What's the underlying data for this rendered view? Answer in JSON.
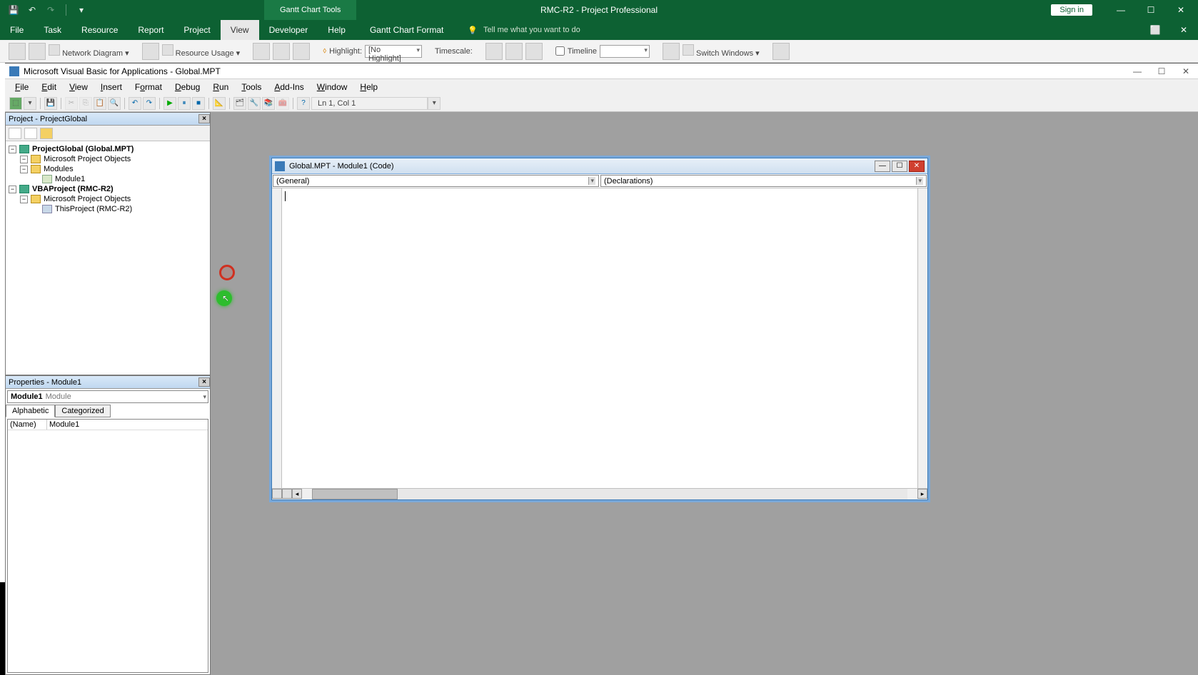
{
  "app": {
    "tool_context": "Gantt Chart Tools",
    "doc_title": "RMC-R2  -  Project Professional",
    "signin": "Sign in"
  },
  "ribbon_tabs": {
    "file": "File",
    "task": "Task",
    "resource": "Resource",
    "report": "Report",
    "project": "Project",
    "view": "View",
    "developer": "Developer",
    "help": "Help",
    "format": "Gantt Chart Format",
    "tell_me": "Tell me what you want to do"
  },
  "ribbon": {
    "network_diagram": "Network Diagram",
    "resource_usage": "Resource Usage",
    "highlight": "Highlight:",
    "highlight_val": "[No Highlight]",
    "timescale": "Timescale:",
    "timeline": "Timeline",
    "switch_windows": "Switch Windows"
  },
  "vba": {
    "title": "Microsoft Visual Basic for Applications - Global.MPT",
    "menu": {
      "file": "File",
      "edit": "Edit",
      "view": "View",
      "insert": "Insert",
      "format": "Format",
      "debug": "Debug",
      "run": "Run",
      "tools": "Tools",
      "addins": "Add-Ins",
      "window": "Window",
      "help": "Help"
    },
    "toolbar_status": "Ln 1, Col 1"
  },
  "project_explorer": {
    "title": "Project - ProjectGlobal",
    "global": "ProjectGlobal (Global.MPT)",
    "ms_objects": "Microsoft Project Objects",
    "modules": "Modules",
    "module1": "Module1",
    "vbaproject": "VBAProject (RMC-R2)",
    "ms_objects2": "Microsoft Project Objects",
    "thisproject": "ThisProject (RMC-R2)"
  },
  "properties": {
    "title": "Properties - Module1",
    "combo_name": "Module1",
    "combo_type": "Module",
    "tab_alpha": "Alphabetic",
    "tab_cat": "Categorized",
    "row_name_key": "(Name)",
    "row_name_val": "Module1"
  },
  "code_window": {
    "title": "Global.MPT - Module1 (Code)",
    "combo_left": "(General)",
    "combo_right": "(Declarations)"
  }
}
